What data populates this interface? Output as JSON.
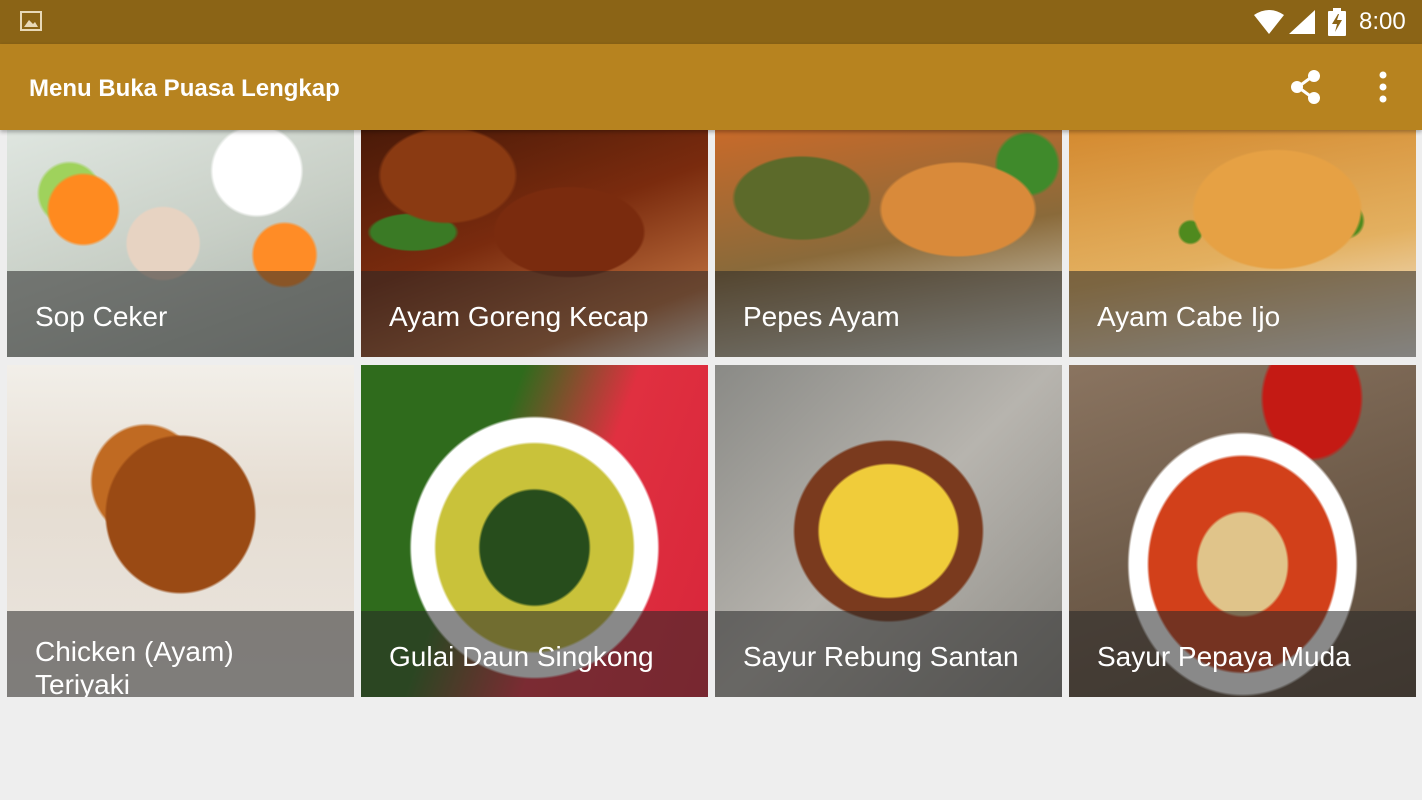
{
  "status_bar": {
    "time": "8:00",
    "icons": [
      "gallery-icon",
      "wifi-icon",
      "signal-icon",
      "battery-charging-icon"
    ],
    "color": "#8b6416"
  },
  "app_bar": {
    "title": "Menu Buka Puasa Lengkap",
    "actions": [
      "share-icon",
      "more-vert-icon"
    ],
    "color": "#b7831f"
  },
  "menu_items": [
    {
      "title": "Sop Ceker"
    },
    {
      "title": "Ayam Goreng Kecap"
    },
    {
      "title": "Pepes Ayam"
    },
    {
      "title": "Ayam Cabe Ijo"
    },
    {
      "title": "Chicken (Ayam) Teriyaki"
    },
    {
      "title": "Gulai Daun Singkong"
    },
    {
      "title": "Sayur Rebung Santan"
    },
    {
      "title": "Sayur Pepaya Muda"
    }
  ]
}
